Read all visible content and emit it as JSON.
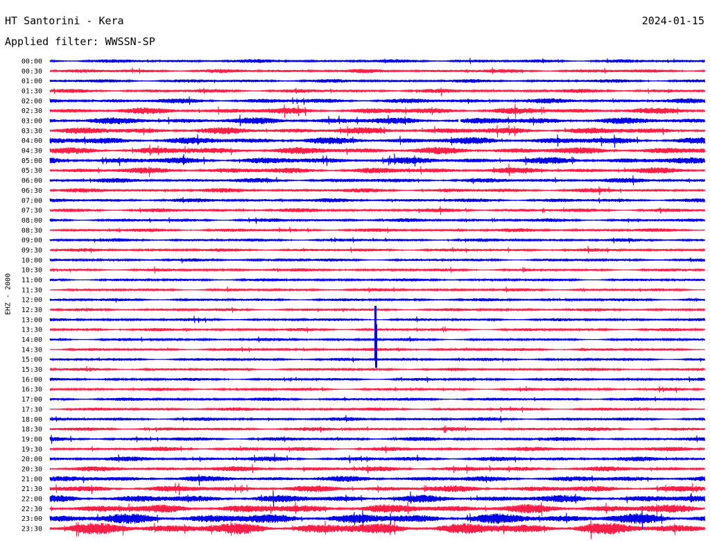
{
  "header": {
    "title": "HT Santorini - Kera",
    "filter": "Applied filter: WWSSN-SP",
    "date": "2024-01-15",
    "channel": "EHZ - 2000"
  },
  "colors": {
    "trace_a": "#0000e6",
    "trace_b": "#ff1e46",
    "background": "#ffffff",
    "text": "#000000"
  },
  "chart_data": {
    "type": "line",
    "title": "HT Santorini - Kera",
    "subtitle": "Applied filter: WWSSN-SP",
    "ylabel": "EHZ - 2000",
    "xlabel": "",
    "row_labels": [
      "00:00",
      "00:30",
      "01:00",
      "01:30",
      "02:00",
      "02:30",
      "03:00",
      "03:30",
      "04:00",
      "04:30",
      "05:00",
      "05:30",
      "06:00",
      "06:30",
      "07:00",
      "07:30",
      "08:00",
      "08:30",
      "09:00",
      "09:30",
      "10:00",
      "10:30",
      "11:00",
      "11:30",
      "12:00",
      "12:30",
      "13:00",
      "13:30",
      "14:00",
      "14:30",
      "15:00",
      "15:30",
      "16:00",
      "16:30",
      "17:00",
      "17:30",
      "18:00",
      "18:30",
      "19:00",
      "19:30",
      "20:00",
      "20:30",
      "21:00",
      "21:30",
      "22:00",
      "22:30",
      "23:00",
      "23:30"
    ],
    "row_noise_level": [
      0.55,
      0.6,
      0.55,
      0.6,
      0.75,
      0.95,
      1.0,
      1.0,
      1.05,
      1.05,
      1.0,
      0.9,
      0.7,
      0.65,
      0.6,
      0.6,
      0.55,
      0.55,
      0.5,
      0.5,
      0.45,
      0.45,
      0.45,
      0.45,
      0.45,
      0.45,
      0.45,
      0.45,
      0.45,
      0.45,
      0.45,
      0.45,
      0.45,
      0.45,
      0.5,
      0.5,
      0.55,
      0.55,
      0.6,
      0.65,
      0.7,
      0.75,
      0.85,
      0.95,
      1.1,
      1.3,
      1.5,
      1.7
    ],
    "series_colors": [
      "blue",
      "red"
    ],
    "grid": false
  }
}
